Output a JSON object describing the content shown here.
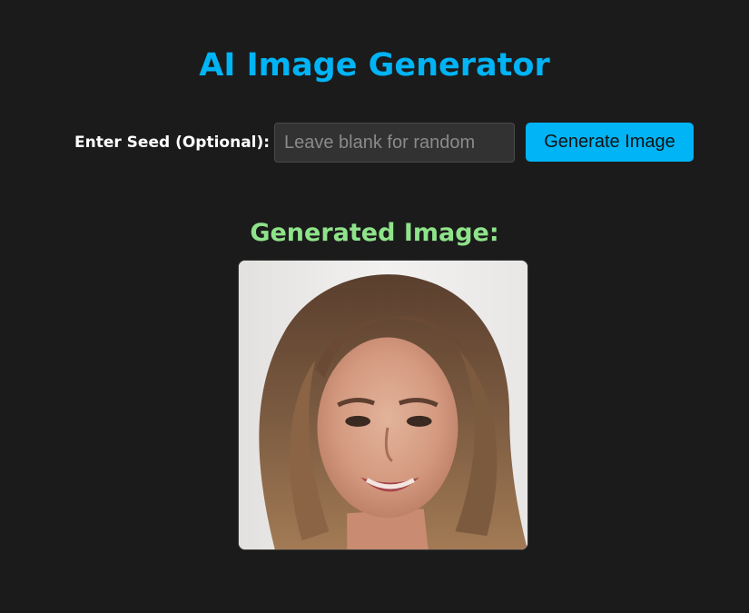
{
  "app": {
    "title": "AI Image Generator",
    "title_color": "#00b4f5"
  },
  "seed": {
    "label": "Enter Seed (Optional):",
    "placeholder": "Leave blank for random",
    "value": ""
  },
  "actions": {
    "generate_label": "Generate Image",
    "button_color": "#00b4f5"
  },
  "result": {
    "heading": "Generated Image:",
    "heading_color": "#8fe38a",
    "image_alt": "generated portrait of a smiling woman with long brown hair"
  }
}
